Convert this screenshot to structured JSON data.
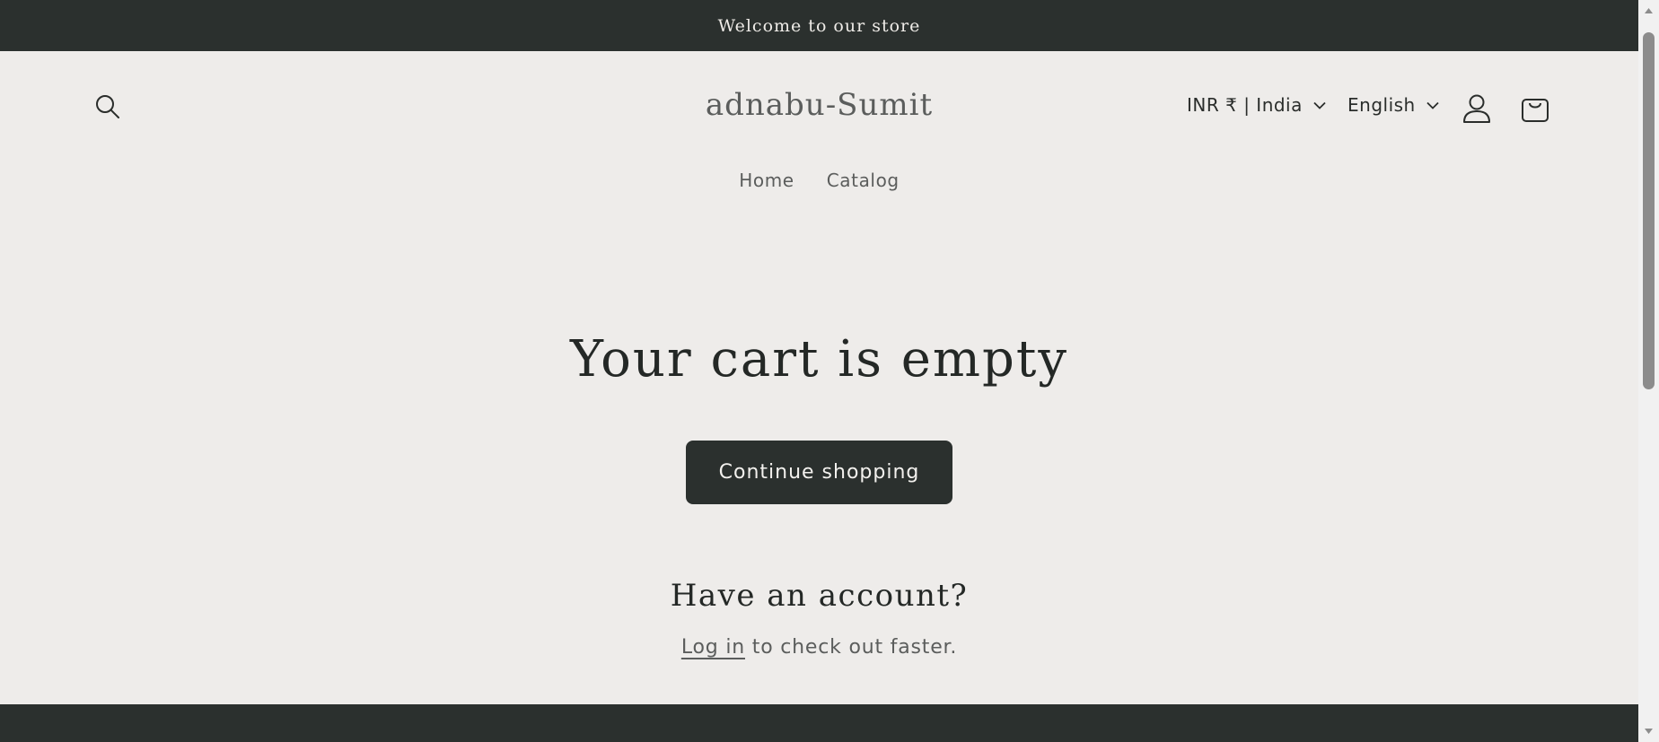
{
  "announcement": {
    "text": "Welcome to our store"
  },
  "header": {
    "store_name": "adnabu-Sumit",
    "currency_selector": "INR ₹ | India",
    "language_selector": "English",
    "icons": {
      "search": "search-icon",
      "account": "account-icon",
      "cart": "cart-icon",
      "chevron": "chevron-down-icon"
    }
  },
  "nav": {
    "items": [
      {
        "label": "Home"
      },
      {
        "label": "Catalog"
      }
    ]
  },
  "main": {
    "title": "Your cart is empty",
    "continue_button": "Continue shopping",
    "account_heading": "Have an account?",
    "login_link": "Log in",
    "login_suffix": " to check out faster."
  },
  "colors": {
    "page_bg": "#eeecea",
    "dark_accent": "#2b302e",
    "text_dark": "#242826",
    "text_muted": "#5b5d5c"
  }
}
